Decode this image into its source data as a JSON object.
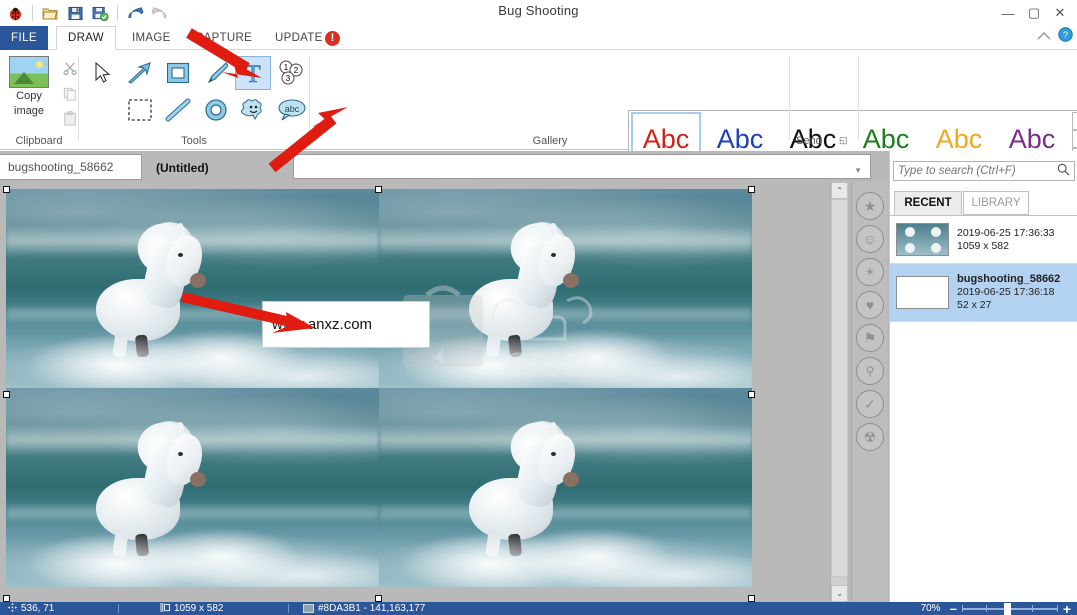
{
  "window": {
    "title": "Bug Shooting",
    "controls": {
      "minimize": "—",
      "maximize": "▢",
      "close": "✕"
    }
  },
  "quick_access": [
    {
      "name": "app-ladybug-icon",
      "label": "Bug Shooting"
    },
    {
      "name": "open-icon",
      "label": "Open"
    },
    {
      "name": "save-icon",
      "label": "Save"
    },
    {
      "name": "save-as-icon",
      "label": "Save As"
    },
    {
      "name": "undo-icon",
      "label": "Undo"
    },
    {
      "name": "redo-icon",
      "label": "Redo"
    }
  ],
  "ribbon_tabs": [
    {
      "key": "file",
      "label": "FILE",
      "active": false
    },
    {
      "key": "draw",
      "label": "DRAW",
      "active": true
    },
    {
      "key": "image",
      "label": "IMAGE",
      "active": false
    },
    {
      "key": "capture",
      "label": "CAPTURE",
      "active": false
    },
    {
      "key": "update",
      "label": "UPDATE",
      "active": false,
      "badge": "!"
    }
  ],
  "ribbon": {
    "clipboard": {
      "group_label": "Clipboard",
      "copy_image_line1": "Copy",
      "copy_image_line2": "image",
      "cut_icon": "scissors-icon",
      "copy_icon": "copy-icon",
      "paste_icon": "paste-icon"
    },
    "tools": {
      "group_label": "Tools",
      "items": [
        {
          "name": "select-cursor-tool",
          "glyph": "➚",
          "selected": false
        },
        {
          "name": "arrow-tool",
          "glyph": "↗",
          "selected": false
        },
        {
          "name": "rectangle-tool",
          "glyph": "▢",
          "selected": false
        },
        {
          "name": "pen-tool",
          "glyph": "✎",
          "selected": false
        },
        {
          "name": "text-tool",
          "glyph": "T",
          "selected": true
        },
        {
          "name": "numbering-tool",
          "glyph": "①②③",
          "selected": false
        },
        {
          "name": "marquee-tool",
          "glyph": "▫",
          "selected": false
        },
        {
          "name": "line-tool",
          "glyph": "╱",
          "selected": false
        },
        {
          "name": "ellipse-tool",
          "glyph": "◯",
          "selected": false
        },
        {
          "name": "obfuscate-tool",
          "glyph": "☺",
          "selected": false
        },
        {
          "name": "callout-tool",
          "glyph": "abc",
          "selected": false
        }
      ]
    },
    "gallery": {
      "group_label": "Gallery",
      "items": [
        {
          "label": "Abc",
          "color": "#d0211c",
          "selected": true
        },
        {
          "label": "Abc",
          "color": "#1f3fbf",
          "selected": false
        },
        {
          "label": "Abc",
          "color": "#101010",
          "selected": false
        },
        {
          "label": "Abc",
          "color": "#1a7f1a",
          "selected": false
        },
        {
          "label": "Abc",
          "color": "#f0a81e",
          "selected": false
        },
        {
          "label": "Abc",
          "color": "#7b2b8c",
          "selected": false
        }
      ],
      "scroll_up": "▲",
      "scroll_down": "▼",
      "scroll_more": "▼"
    },
    "send": {
      "group_label": "Send",
      "icon": "share-icon",
      "launcher": "◱"
    }
  },
  "ribbon_right": {
    "collapse": "⌃",
    "help": "?"
  },
  "document_tabs": [
    {
      "label": "bugshooting_58662",
      "active": false
    },
    {
      "label": "(Untitled)",
      "active": true
    }
  ],
  "document_tabs_caret": "▼",
  "canvas": {
    "image_alt": "white horse running through sea waves, tiled 2x2",
    "text_annotation": "www.anxz.com",
    "watermark_text": "anxz.com"
  },
  "icon_rail": [
    {
      "name": "star-icon",
      "glyph": "★"
    },
    {
      "name": "smiley-icon",
      "glyph": "☺"
    },
    {
      "name": "lightbulb-icon",
      "glyph": "💡"
    },
    {
      "name": "heart-icon",
      "glyph": "♥"
    },
    {
      "name": "flag-icon",
      "glyph": "⚑"
    },
    {
      "name": "bookmark-icon",
      "glyph": "🔖"
    },
    {
      "name": "check-icon",
      "glyph": "✓"
    },
    {
      "name": "radiation-icon",
      "glyph": "☢"
    }
  ],
  "scrollbar": {
    "up": "⌃",
    "down": "⌄"
  },
  "right_panel": {
    "search": {
      "placeholder": "Type to search (Ctrl+F)",
      "value": "",
      "icon": "search-icon"
    },
    "tabs": [
      {
        "label": "RECENT",
        "active": true
      },
      {
        "label": "LIBRARY",
        "active": false
      }
    ],
    "items": [
      {
        "title": "",
        "timestamp": "2019-06-25 17:36:33",
        "size": "1059 x 582",
        "selected": false,
        "thumb": "photo"
      },
      {
        "title": "bugshooting_58662",
        "timestamp": "2019-06-25 17:36:18",
        "size": "52 x 27",
        "selected": true,
        "thumb": "blank"
      }
    ]
  },
  "status_bar": {
    "cursor_icon": "move-icon",
    "cursor_position": "536, 71",
    "size_icon": "dimensions-icon",
    "image_size": "1059 x 582",
    "color_swatch": "#8DA3B1",
    "color_text": "#8DA3B1 - 141,163,177",
    "zoom_level": "70%",
    "zoom_out": "–",
    "zoom_in": "+"
  }
}
